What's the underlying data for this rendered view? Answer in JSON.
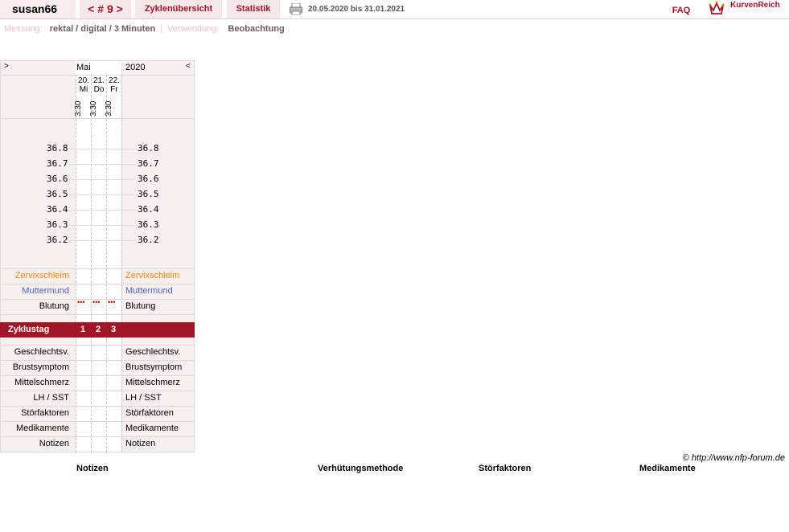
{
  "topbar": {
    "user": "susan66",
    "cycle_nav": "< # 9 >",
    "overview": "Zyklenübersicht",
    "statistics": "Statistik",
    "date_range": "20.05.2020 bis 31.01.2021",
    "faq": "FAQ",
    "brand": "KurvenReich"
  },
  "meta": {
    "measure_label": "Messung:",
    "measure_value": "rektal / digital / 3 Minuten",
    "separator": "|",
    "usage_label": "Verwendung:",
    "usage_value": "Beobachtung"
  },
  "chart": {
    "nav_prev": ">",
    "nav_next": "<",
    "month": "Mai",
    "year": "2020",
    "days": [
      {
        "date": "20.",
        "weekday": "Mi",
        "time": "3:30"
      },
      {
        "date": "21.",
        "weekday": "Do",
        "time": "3:30"
      },
      {
        "date": "22.",
        "weekday": "Fr",
        "time": "3:30"
      }
    ],
    "temperatures": [
      "36.8",
      "36.7",
      "36.6",
      "36.5",
      "36.4",
      "36.3",
      "36.2"
    ],
    "rows_upper": {
      "cervix": "Zervixschleim",
      "os": "Muttermund",
      "bleeding": "Blutung",
      "bleeding_marks": "•••"
    },
    "cycle_day_label": "Zyklustag",
    "cycle_days": [
      "1",
      "2",
      "3"
    ],
    "rows_lower": [
      "Geschlechtsv.",
      "Brustsymptom",
      "Mittelschmerz",
      "LH / SST",
      "Störfaktoren",
      "Medikamente",
      "Notizen"
    ],
    "colors": {
      "cervix": "#e8850e",
      "os": "#4a5fbf",
      "accent": "#a11526",
      "bleeding": "#cc0000"
    }
  },
  "footer": {
    "copyright": "© http://www.nfp-forum.de",
    "columns": [
      "Notizen",
      "Verhütungsmethode",
      "Störfaktoren",
      "Medikamente"
    ]
  }
}
